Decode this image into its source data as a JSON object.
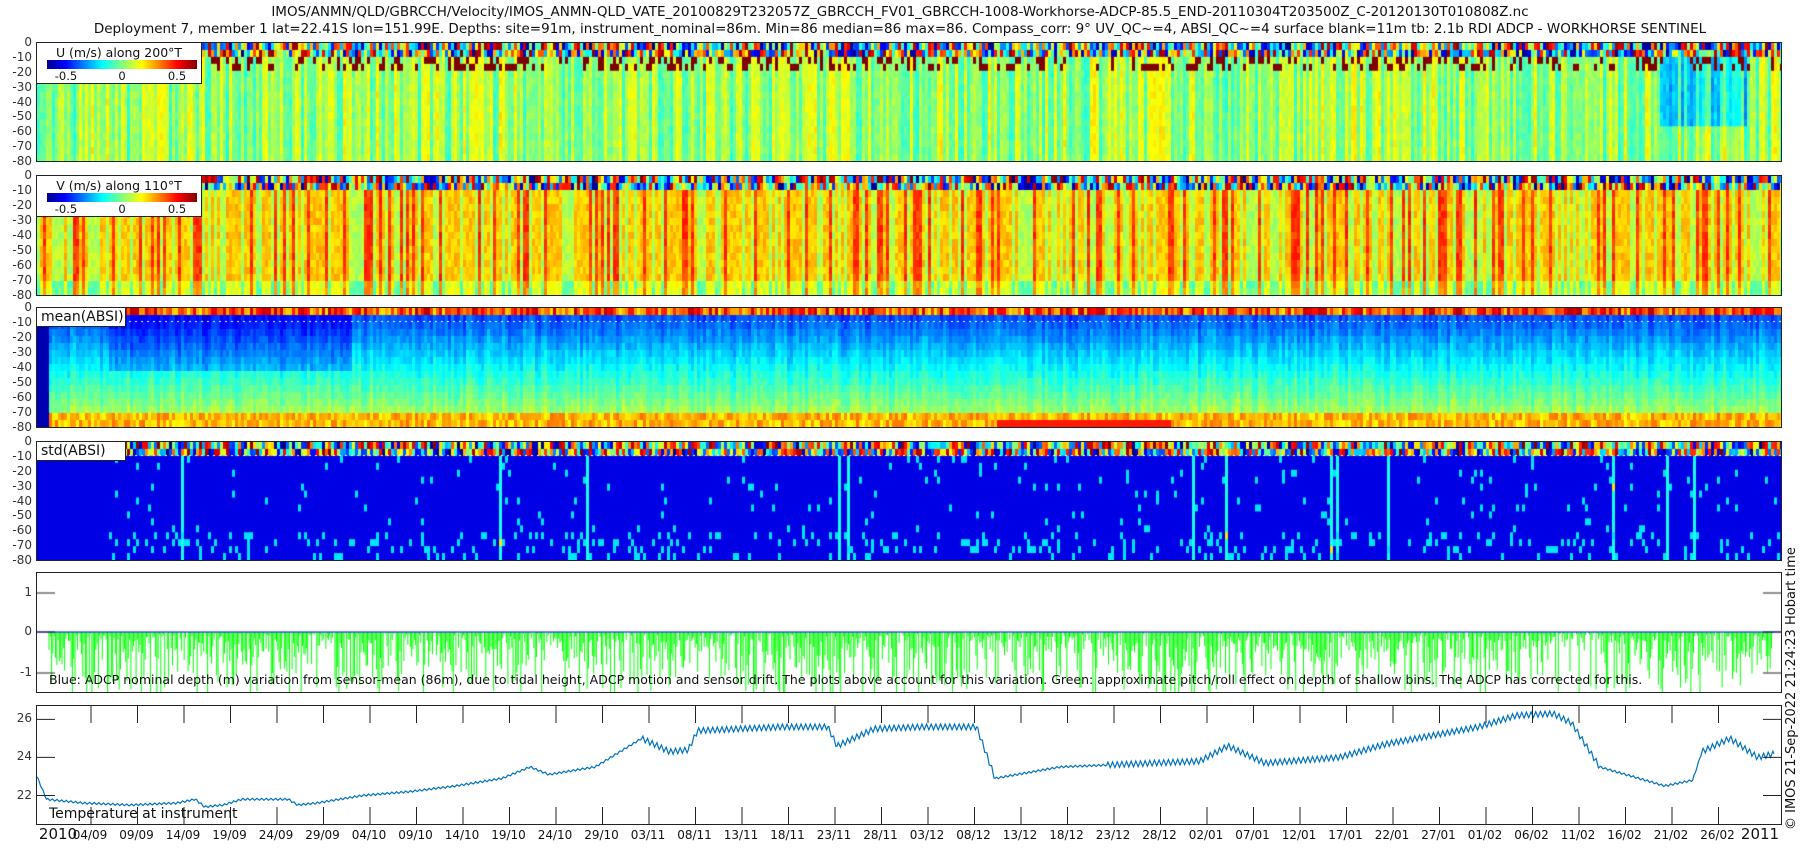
{
  "title": {
    "line1": "IMOS/ANMN/QLD/GBRCCH/Velocity/IMOS_ANMN-QLD_VATE_20100829T232057Z_GBRCCH_FV01_GBRCCH-1008-Workhorse-ADCP-85.5_END-20110304T203500Z_C-20120130T010808Z.nc",
    "line2": "Deployment 7, member 1 lat=22.41S lon=151.99E. Depths: site=91m, instrument_nominal=86m. Min=86 median=86 max=86. Compass_corr: 9° UV_QC~=4, ABSI_QC~=4 surface blank=11m tb: 2.1b RDI ADCP - WORKHORSE SENTINEL"
  },
  "side_text": "© IMOS 21-Sep-2022 21:24:23 Hobart time",
  "depth_ticks": [
    "0",
    "-10",
    "-20",
    "-30",
    "-40",
    "-50",
    "-60",
    "-70",
    "-80"
  ],
  "chart_data": [
    {
      "type": "heatmap",
      "id": "u",
      "legend_title": "U (m/s) along 200°T",
      "colorbar_ticks": [
        "-0.5",
        "0",
        "0.5"
      ],
      "clim": [
        -0.7,
        0.7
      ],
      "ylim": [
        -80,
        0
      ],
      "colormap": "jet",
      "typical_value": 0.05
    },
    {
      "type": "heatmap",
      "id": "v",
      "legend_title": "V (m/s) along 110°T",
      "colorbar_ticks": [
        "-0.5",
        "0",
        "0.5"
      ],
      "clim": [
        -0.7,
        0.7
      ],
      "ylim": [
        -80,
        0
      ],
      "colormap": "jet",
      "typical_value": 0.2
    },
    {
      "type": "heatmap",
      "id": "mean",
      "label": "mean(ABSI)",
      "ylim": [
        -80,
        0
      ],
      "colormap": "jet"
    },
    {
      "type": "heatmap",
      "id": "std",
      "label": "std(ABSI)",
      "ylim": [
        -80,
        0
      ],
      "colormap": "jet"
    },
    {
      "type": "line",
      "id": "depth",
      "yticks": [
        "1",
        "0",
        "-1"
      ],
      "ylim": [
        -1.5,
        1.5
      ],
      "caption": "Blue: ADCP nominal depth (m) variation from sensor-mean (86m), due to tidal height, ADCP motion and sensor drift. The plots above account for this variation. Green: approximate pitch/roll effect on depth of shallow bins. The ADCP has corrected for this.",
      "series": [
        {
          "name": "nominal depth variation",
          "color": "#0000ff",
          "value": 0
        },
        {
          "name": "pitch/roll effect",
          "color": "#00ff00"
        }
      ]
    },
    {
      "type": "line",
      "id": "temp",
      "caption": "Temperature at instrument",
      "yticks": [
        "26",
        "24",
        "22"
      ],
      "ylim": [
        20.5,
        26.7
      ],
      "color": "#0072bd",
      "points": [
        [
          "2010-08-29T23",
          23.0
        ],
        [
          "2010-08-31",
          21.8
        ],
        [
          "2010-09-04",
          21.6
        ],
        [
          "2010-09-09",
          21.5
        ],
        [
          "2010-09-14",
          21.6
        ],
        [
          "2010-09-16",
          21.8
        ],
        [
          "2010-09-17",
          21.4
        ],
        [
          "2010-09-19",
          21.5
        ],
        [
          "2010-09-21",
          21.8
        ],
        [
          "2010-09-26",
          21.8
        ],
        [
          "2010-09-27",
          21.5
        ],
        [
          "2010-09-29",
          21.6
        ],
        [
          "2010-10-04",
          22.0
        ],
        [
          "2010-10-09",
          22.2
        ],
        [
          "2010-10-14",
          22.5
        ],
        [
          "2010-10-19",
          22.9
        ],
        [
          "2010-10-22",
          23.5
        ],
        [
          "2010-10-24",
          23.1
        ],
        [
          "2010-10-29",
          23.5
        ],
        [
          "2010-11-03",
          25.0
        ],
        [
          "2010-11-06",
          24.3
        ],
        [
          "2010-11-08",
          24.4
        ],
        [
          "2010-11-09",
          25.4
        ],
        [
          "2010-11-18",
          25.6
        ],
        [
          "2010-11-23",
          25.6
        ],
        [
          "2010-11-24",
          24.6
        ],
        [
          "2010-11-28",
          25.5
        ],
        [
          "2010-12-03",
          25.6
        ],
        [
          "2010-12-09",
          25.6
        ],
        [
          "2010-12-11",
          22.9
        ],
        [
          "2010-12-18",
          23.5
        ],
        [
          "2010-12-23",
          23.6
        ],
        [
          "2011-01-02",
          23.8
        ],
        [
          "2011-01-05",
          24.6
        ],
        [
          "2011-01-09",
          23.7
        ],
        [
          "2011-01-17",
          24.0
        ],
        [
          "2011-01-22",
          24.7
        ],
        [
          "2011-02-01",
          25.6
        ],
        [
          "2011-02-05",
          26.2
        ],
        [
          "2011-02-09",
          26.3
        ],
        [
          "2011-02-11",
          25.8
        ],
        [
          "2011-02-14",
          23.5
        ],
        [
          "2011-02-21",
          22.5
        ],
        [
          "2011-02-24",
          22.8
        ],
        [
          "2011-02-25",
          24.3
        ],
        [
          "2011-02-28",
          25.0
        ],
        [
          "2011-03-03",
          24.0
        ],
        [
          "2011-03-04T20",
          24.2
        ]
      ]
    }
  ],
  "time_axis": {
    "start": "2010-08-29T23:20",
    "end": "2011-03-04T20:35",
    "year_start": "2010",
    "year_end": "2011",
    "ticks": [
      "04/09",
      "09/09",
      "14/09",
      "19/09",
      "24/09",
      "29/09",
      "04/10",
      "09/10",
      "14/10",
      "19/10",
      "24/10",
      "29/10",
      "03/11",
      "08/11",
      "13/11",
      "18/11",
      "23/11",
      "28/11",
      "03/12",
      "08/12",
      "13/12",
      "18/12",
      "23/12",
      "28/12",
      "02/01",
      "07/01",
      "12/01",
      "17/01",
      "22/01",
      "27/01",
      "01/02",
      "06/02",
      "11/02",
      "16/02",
      "21/02",
      "26/02"
    ]
  }
}
